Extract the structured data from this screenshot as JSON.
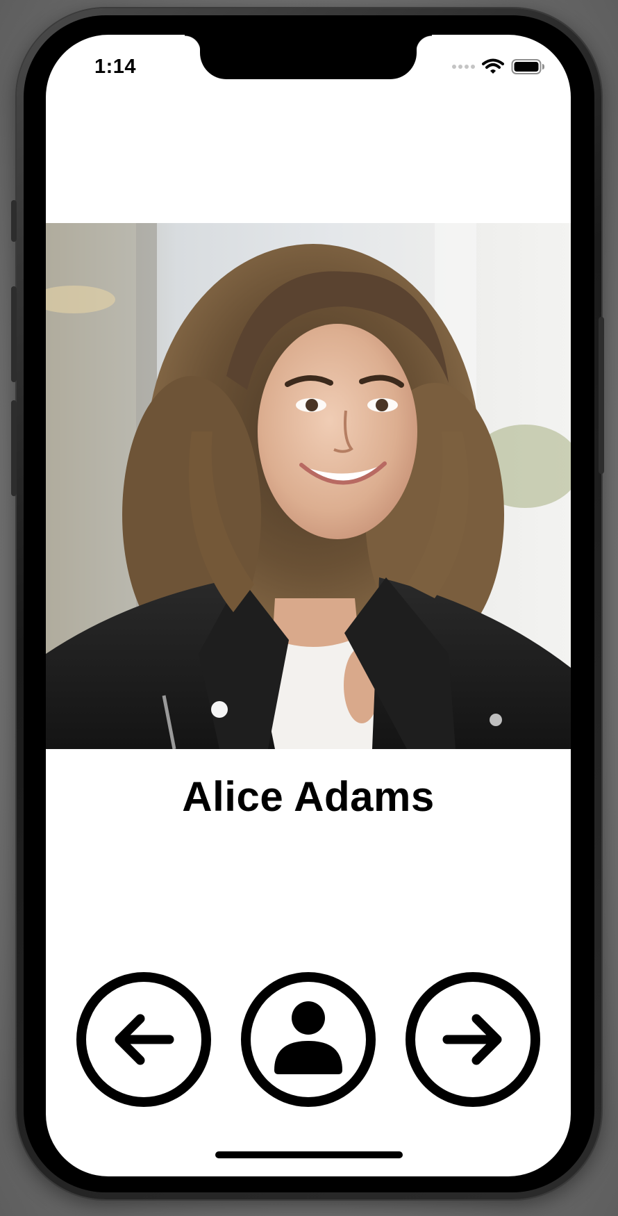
{
  "status_bar": {
    "time": "1:14",
    "icons": [
      "signal-dots-icon",
      "wifi-icon",
      "battery-icon"
    ]
  },
  "profile": {
    "name": "Alice Adams",
    "photo": "portrait-photo"
  },
  "nav_buttons": [
    {
      "name": "previous-button",
      "icon": "arrow-left-icon"
    },
    {
      "name": "profile-button",
      "icon": "person-icon"
    },
    {
      "name": "next-button",
      "icon": "arrow-right-icon"
    }
  ],
  "colors": {
    "background": "#ffffff",
    "foreground": "#000000",
    "jacket": "#1c1c1c",
    "shirt": "#f3f1ee"
  }
}
